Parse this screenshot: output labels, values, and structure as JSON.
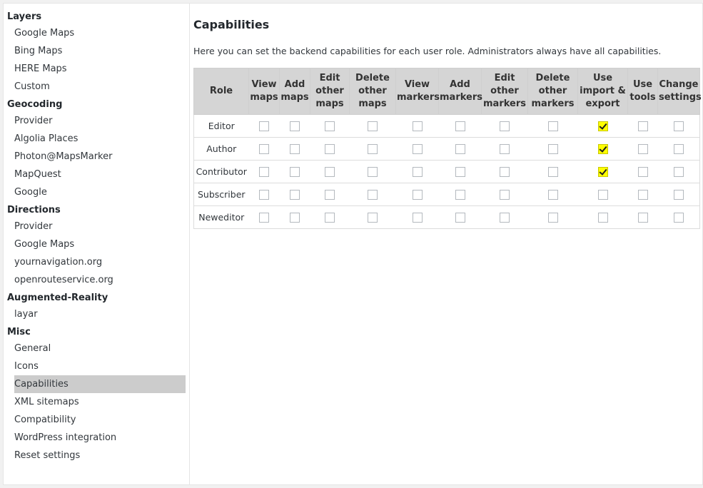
{
  "sidebar": {
    "groups": [
      {
        "title": "Layers",
        "items": [
          "Google Maps",
          "Bing Maps",
          "HERE Maps",
          "Custom"
        ]
      },
      {
        "title": "Geocoding",
        "items": [
          "Provider",
          "Algolia Places",
          "Photon@MapsMarker",
          "MapQuest",
          "Google"
        ]
      },
      {
        "title": "Directions",
        "items": [
          "Provider",
          "Google Maps",
          "yournavigation.org",
          "openrouteservice.org"
        ]
      },
      {
        "title": "Augmented-Reality",
        "items": [
          "layar"
        ]
      },
      {
        "title": "Misc",
        "items": [
          "General",
          "Icons",
          "Capabilities",
          "XML sitemaps",
          "Compatibility",
          "WordPress integration",
          "Reset settings"
        ]
      }
    ],
    "active_item": "Capabilities"
  },
  "main": {
    "title": "Capabilities",
    "description": "Here you can set the backend capabilities for each user role. Administrators always have all capabilities.",
    "table": {
      "headers": [
        "Role",
        "View maps",
        "Add maps",
        "Edit other maps",
        "Delete other maps",
        "View markers",
        "Add markers",
        "Edit other markers",
        "Delete other markers",
        "Use import & export",
        "Use tools",
        "Change settings"
      ],
      "rows": [
        {
          "role": "Editor",
          "checks": [
            false,
            false,
            false,
            false,
            false,
            false,
            false,
            false,
            true,
            false,
            false
          ]
        },
        {
          "role": "Author",
          "checks": [
            false,
            false,
            false,
            false,
            false,
            false,
            false,
            false,
            true,
            false,
            false
          ]
        },
        {
          "role": "Contributor",
          "checks": [
            false,
            false,
            false,
            false,
            false,
            false,
            false,
            false,
            true,
            false,
            false
          ]
        },
        {
          "role": "Subscriber",
          "checks": [
            false,
            false,
            false,
            false,
            false,
            false,
            false,
            false,
            false,
            false,
            false
          ]
        },
        {
          "role": "Neweditor",
          "checks": [
            false,
            false,
            false,
            false,
            false,
            false,
            false,
            false,
            false,
            false,
            false
          ]
        }
      ]
    }
  },
  "colors": {
    "header_bg": "#d5d5d5",
    "active_nav_bg": "#cccccc",
    "highlight": "#ffff00"
  }
}
